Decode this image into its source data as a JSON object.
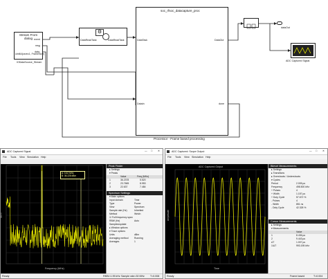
{
  "model": {
    "source_block": {
      "name": "Stream From dialog",
      "output_type": "uint64(csrec1, FrameSize)",
      "label": "IODataSource_Stream",
      "ports": [
        "event",
        "msg",
        "data"
      ]
    },
    "fifo_block": {
      "in_label": "DataReadTask",
      "out_label": "DataReadTask"
    },
    "processor": {
      "title": "soc_rfsoc_datacapture_proc",
      "port_task": "DataTask",
      "port_in": "DataIn",
      "port_out": "DataOut",
      "port_done": "done",
      "caption": "Processor - Frame based processing"
    },
    "out_port": {
      "label": "dataOut"
    },
    "scope": {
      "label": "ADC Captured Signal"
    }
  },
  "spectrum_window": {
    "title": "ADC Captured Signal",
    "menus": [
      "File",
      "Tools",
      "View",
      "Simulation",
      "Help"
    ],
    "status": "Ready",
    "status_rbw": "RBW=1.95 kHz",
    "status_rate": "Sample rate=30 MHz",
    "status_time": "T=0.008",
    "chart_data": {
      "type": "line",
      "xlabel": "Frequency (MHz)",
      "ylabel": "dBm",
      "xlim": [
        0,
        15
      ],
      "ylim": [
        -140,
        20
      ],
      "peak_freq_mhz": 5.52,
      "marker_labels": [
        "A: 5.52 MHz",
        "B: 36.228 dBm"
      ],
      "grid": true
    },
    "peak_finder": {
      "title": "Peak Finder",
      "settings_label": "Settings",
      "peaks_label": "Peaks",
      "columns": [
        "Value",
        "Freq (MHz)"
      ],
      "rows": [
        {
          "value": "36.2378",
          "freq": "5.520"
        },
        {
          "value": "23.7665",
          "freq": "8.953"
        },
        {
          "value": "22.637",
          "freq": "7.484"
        }
      ]
    },
    "spectrum_settings": {
      "title": "Spectrum Settings",
      "section": "Main options",
      "fields": [
        {
          "label": "Input domain",
          "value": "Time"
        },
        {
          "label": "Type",
          "value": "Power"
        },
        {
          "label": "View",
          "value": "Spectrum"
        },
        {
          "label": "Sample rate (Hz)",
          "value": "Inherited"
        },
        {
          "label": "Method",
          "value": "Welch"
        }
      ],
      "full_band": "Full frequency span",
      "rbw_label": "RBW (Hz)",
      "rbw_value": "Auto",
      "samples_label": "Samples/update",
      "window_options": "Window options",
      "trace_options": "Trace options",
      "units_label": "Units",
      "units_value": "dBm",
      "averaging_label": "Averaging method",
      "averaging_value": "Running",
      "avg_count_label": "Averages",
      "avg_count_value": "1"
    }
  },
  "time_window": {
    "title": "ADC Captured: Scope Output",
    "menus": [
      "File",
      "Tools",
      "View",
      "Simulation",
      "Help"
    ],
    "status": "Ready",
    "status_mode": "Frame based",
    "status_time": "T=0.004",
    "chart_data": {
      "type": "line",
      "title": "ADC Captured Output",
      "xlabel": "Time",
      "ylabel": "Amplitude",
      "cycles": 10,
      "grid": true
    },
    "bilevel": {
      "title": "Bilevel Measurements",
      "items": [
        "Settings",
        "Transitions",
        "Overshoots / Undershoots",
        "Cycles"
      ],
      "values": [
        {
          "label": "Period",
          "value": "2.005 µs"
        },
        {
          "label": "Frequency",
          "value": "498.500 kHz"
        },
        {
          "label": "+ Pulses",
          "value": "4"
        },
        {
          "label": "+ Width",
          "value": "1.157 µs"
        },
        {
          "label": "+ Duty Cycle",
          "value": "57.672 %"
        },
        {
          "label": "- Pulses",
          "value": "4"
        },
        {
          "label": "- Width",
          "value": "851 ns"
        },
        {
          "label": "- Duty Cycle",
          "value": "42.328 %"
        }
      ]
    },
    "cursor": {
      "title": "Cursor Measurements",
      "items": [
        "Settings",
        "Measurements"
      ],
      "columns": [
        "",
        "Value"
      ],
      "rows": [
        {
          "label": "1",
          "value": "8.436 µs"
        },
        {
          "label": "2",
          "value": "9.443 µs"
        }
      ],
      "dt_label": "ΔT",
      "dt_value": "1.007 µs",
      "f_label": "1/ΔT",
      "f_value": "993.195 kHz"
    }
  },
  "colors": {
    "trace": "#e8e800",
    "scope_bg": "#000000",
    "grid": "#303030",
    "panel_head": "#222222",
    "marker": "#ffff99"
  }
}
